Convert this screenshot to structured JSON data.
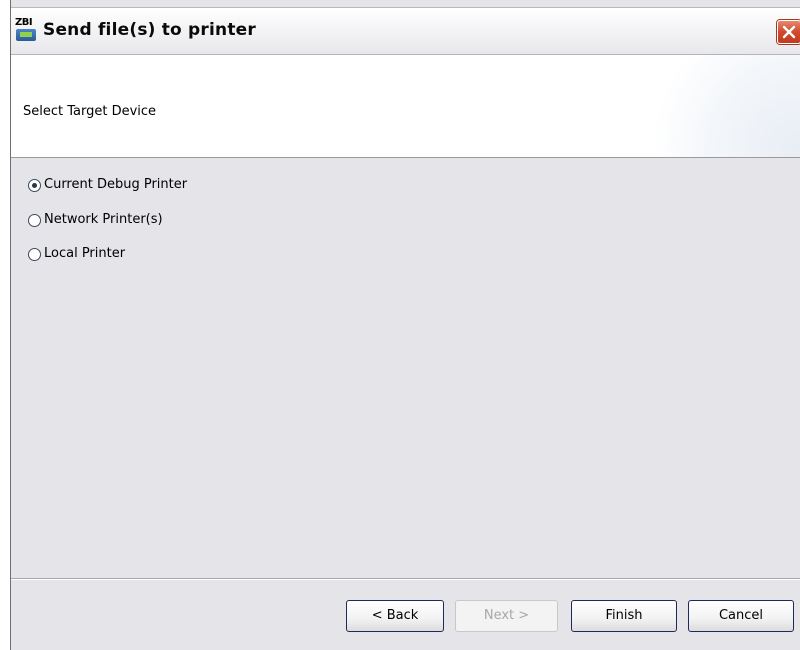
{
  "window": {
    "title": "Send file(s) to printer",
    "app_icon_text": "ZBI"
  },
  "header": {
    "title": "Select Target Device"
  },
  "target_options": [
    {
      "label": "Current Debug Printer",
      "checked": true
    },
    {
      "label": "Network Printer(s)",
      "checked": false
    },
    {
      "label": "Local Printer",
      "checked": false
    }
  ],
  "buttons": {
    "back": "< Back",
    "next": "Next >",
    "finish": "Finish",
    "cancel": "Cancel"
  },
  "icons": {
    "app": "zbi-printer-icon",
    "close": "close-icon"
  },
  "colors": {
    "close_button": "#d04a2c",
    "dialog_background": "#e5e4e8",
    "button_border": "#1e2a5c"
  }
}
